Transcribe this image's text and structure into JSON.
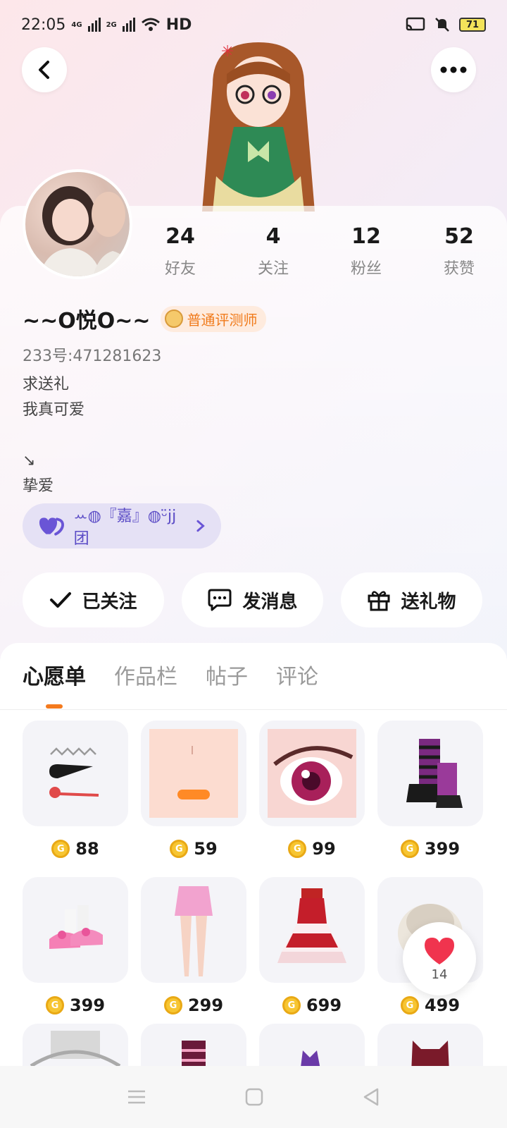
{
  "status_bar": {
    "time": "22:05",
    "net1": "4G",
    "net2": "2G",
    "hd": "HD",
    "battery": "71"
  },
  "header": {
    "back_icon": "chevron-left-icon",
    "more_icon": "more-dots-icon"
  },
  "stats": [
    {
      "value": "24",
      "label": "好友"
    },
    {
      "value": "4",
      "label": "关注"
    },
    {
      "value": "12",
      "label": "粉丝"
    },
    {
      "value": "52",
      "label": "获赞"
    }
  ],
  "profile": {
    "nickname": "~~O悦O~~",
    "badge": "普通评测师",
    "uid": "233号:471281623",
    "bio_lines": [
      "求送礼",
      "我真可爱",
      "",
      "↘",
      "挚爱"
    ],
    "group_chip": "ꕀ◍『嘉』◍ᵕ̈jj团"
  },
  "actions": {
    "follow": "已关注",
    "message": "发消息",
    "gift": "送礼物"
  },
  "tabs": [
    "心愿单",
    "作品栏",
    "帖子",
    "评论"
  ],
  "wishlist": [
    {
      "icon": "hairpin-icon",
      "price": "88"
    },
    {
      "icon": "face-mouth-icon",
      "price": "59"
    },
    {
      "icon": "anime-eye-icon",
      "price": "99"
    },
    {
      "icon": "striped-boots-icon",
      "price": "399"
    },
    {
      "icon": "pink-sandals-icon",
      "price": "399"
    },
    {
      "icon": "pink-skirt-icon",
      "price": "299"
    },
    {
      "icon": "red-dress-icon",
      "price": "699"
    },
    {
      "icon": "white-hat-icon",
      "price": "499"
    }
  ],
  "like": {
    "count": "14"
  },
  "colors": {
    "accent": "#f47a1e",
    "coin": "#f7c531",
    "chip_bg": "#e5e1f5",
    "chip_text": "#5b4cc6"
  }
}
